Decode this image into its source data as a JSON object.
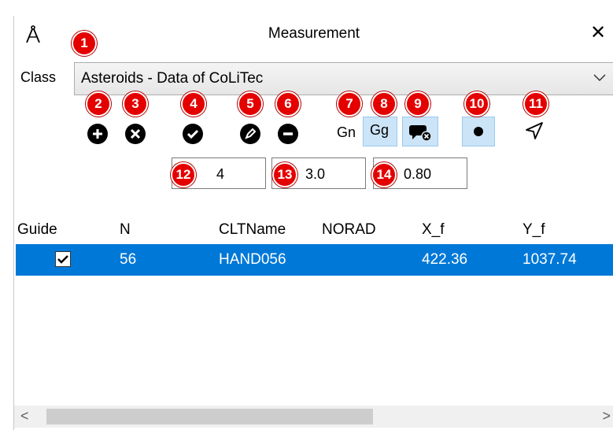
{
  "window": {
    "title": "Measurement",
    "close_glyph": "✕"
  },
  "class_selector": {
    "label": "Class",
    "value": "Asteroids - Data of CoLiTec"
  },
  "toolbar": {
    "gn_label": "Gn",
    "gg_label": "Gg"
  },
  "spinners": {
    "first": "4",
    "second": "3.0",
    "third": "0.80"
  },
  "badges": [
    "1",
    "2",
    "3",
    "4",
    "5",
    "6",
    "7",
    "8",
    "9",
    "10",
    "11",
    "12",
    "13",
    "14"
  ],
  "table": {
    "headers": [
      "Guide",
      "N",
      "CLTName",
      "NORAD",
      "X_f",
      "Y_f"
    ],
    "rows": [
      {
        "guide_checked": true,
        "n": "56",
        "cltname": "HAND056",
        "norad": "",
        "x_f": "422.36",
        "y_f": "1037.74"
      }
    ]
  },
  "colors": {
    "selection": "#0078d7",
    "badge": "#e50000",
    "toggle_bg": "#cce4f7"
  }
}
